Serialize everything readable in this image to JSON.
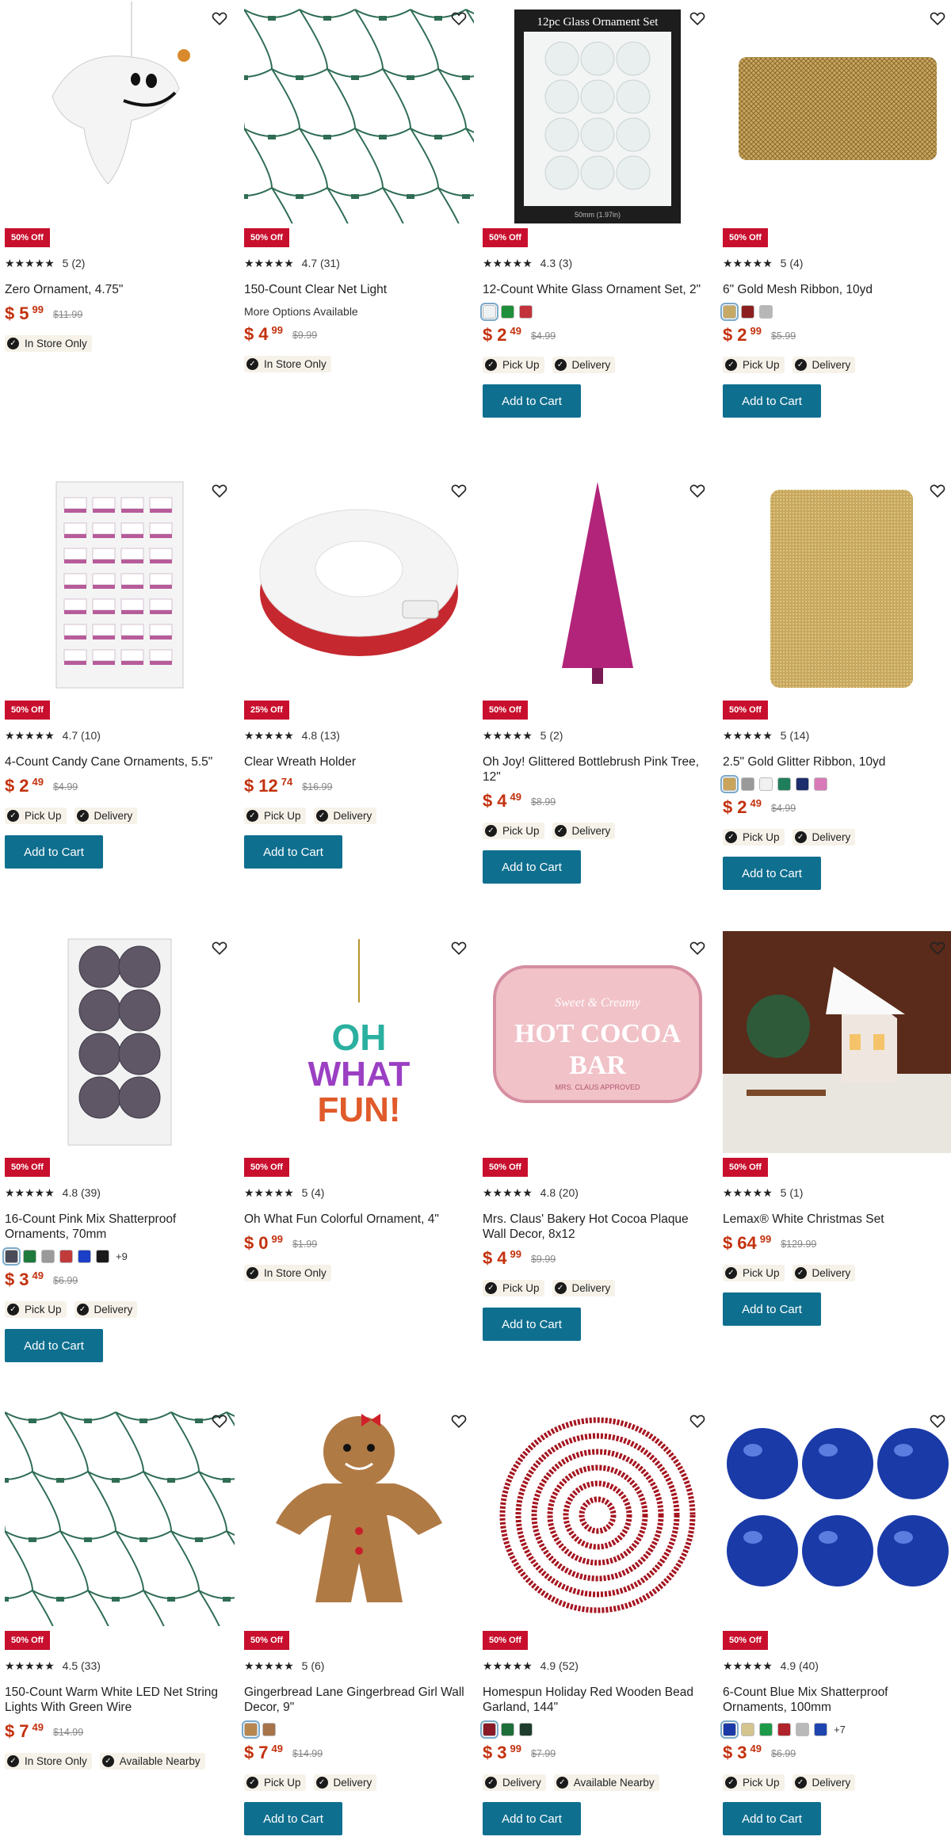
{
  "colors": {
    "sale_badge": "#c8102e",
    "price": "#c3310e",
    "button": "#0f6f8f"
  },
  "products": [
    {
      "name": "Zero Ornament, 4.75\"",
      "badge": "50% Off",
      "rating": "5",
      "reviews": "(2)",
      "currency": "$",
      "dollars": "5",
      "cents": "99",
      "was": "$11.99",
      "pills": [
        "In Store Only"
      ],
      "cart": ""
    },
    {
      "name": "150-Count Clear Net Light",
      "more": "More Options Available",
      "badge": "50% Off",
      "rating": "4.7",
      "reviews": "(31)",
      "currency": "$",
      "dollars": "4",
      "cents": "99",
      "was": "$9.99",
      "pills": [
        "In Store Only"
      ],
      "cart": ""
    },
    {
      "name": "12-Count White Glass Ornament Set, 2\"",
      "badge": "50% Off",
      "rating": "4.3",
      "reviews": "(3)",
      "currency": "$",
      "dollars": "2",
      "cents": "49",
      "was": "$4.99",
      "pills": [
        "Pick Up",
        "Delivery"
      ],
      "cart": "Add to Cart",
      "image_label": "12pc Glass Ornament Set",
      "image_caption": "50mm (1.97in)"
    },
    {
      "name": "6\" Gold Mesh Ribbon, 10yd",
      "badge": "50% Off",
      "rating": "5",
      "reviews": "(4)",
      "currency": "$",
      "dollars": "2",
      "cents": "99",
      "was": "$5.99",
      "pills": [
        "Pick Up",
        "Delivery"
      ],
      "cart": "Add to Cart"
    },
    {
      "name": "4-Count Candy Cane Ornaments, 5.5\"",
      "badge": "50% Off",
      "rating": "4.7",
      "reviews": "(10)",
      "currency": "$",
      "dollars": "2",
      "cents": "49",
      "was": "$4.99",
      "pills": [
        "Pick Up",
        "Delivery"
      ],
      "cart": "Add to Cart"
    },
    {
      "name": "Clear Wreath Holder",
      "badge": "25% Off",
      "rating": "4.8",
      "reviews": "(13)",
      "currency": "$",
      "dollars": "12",
      "cents": "74",
      "was": "$16.99",
      "pills": [
        "Pick Up",
        "Delivery"
      ],
      "cart": "Add to Cart"
    },
    {
      "name": "Oh Joy! Glittered Bottlebrush Pink Tree, 12\"",
      "badge": "50% Off",
      "rating": "5",
      "reviews": "(2)",
      "currency": "$",
      "dollars": "4",
      "cents": "49",
      "was": "$8.99",
      "pills": [
        "Pick Up",
        "Delivery"
      ],
      "cart": "Add to Cart"
    },
    {
      "name": "2.5\" Gold Glitter Ribbon, 10yd",
      "badge": "50% Off",
      "rating": "5",
      "reviews": "(14)",
      "currency": "$",
      "dollars": "2",
      "cents": "49",
      "was": "$4.99",
      "pills": [
        "Pick Up",
        "Delivery"
      ],
      "cart": "Add to Cart"
    },
    {
      "name": "16-Count Pink Mix Shatterproof Ornaments, 70mm",
      "badge": "50% Off",
      "rating": "4.8",
      "reviews": "(39)",
      "currency": "$",
      "dollars": "3",
      "cents": "49",
      "was": "$6.99",
      "pills": [
        "Pick Up",
        "Delivery"
      ],
      "cart": "Add to Cart",
      "swatch_more": "+9"
    },
    {
      "name": "Oh What Fun Colorful Ornament, 4\"",
      "badge": "50% Off",
      "rating": "5",
      "reviews": "(4)",
      "currency": "$",
      "dollars": "0",
      "cents": "99",
      "was": "$1.99",
      "pills": [
        "In Store Only"
      ],
      "cart": "",
      "image_label": "OH WHAT FUN!"
    },
    {
      "name": "Mrs. Claus' Bakery Hot Cocoa Plaque Wall Decor, 8x12",
      "badge": "50% Off",
      "rating": "4.8",
      "reviews": "(20)",
      "currency": "$",
      "dollars": "4",
      "cents": "99",
      "was": "$9.99",
      "pills": [
        "Pick Up",
        "Delivery"
      ],
      "cart": "Add to Cart",
      "image_label": "HOT COCOA BAR",
      "image_sub": "Sweet & Creamy",
      "image_caption": "MRS. CLAUS APPROVED"
    },
    {
      "name": "Lemax® White Christmas Set",
      "badge": "50% Off",
      "rating": "5",
      "reviews": "(1)",
      "currency": "$",
      "dollars": "64",
      "cents": "99",
      "was": "$129.99",
      "pills": [
        "Pick Up",
        "Delivery"
      ],
      "cart": "Add to Cart"
    },
    {
      "name": "150-Count Warm White LED Net String Lights With Green Wire",
      "badge": "50% Off",
      "rating": "4.5",
      "reviews": "(33)",
      "currency": "$",
      "dollars": "7",
      "cents": "49",
      "was": "$14.99",
      "pills": [
        "In Store Only",
        "Available Nearby"
      ],
      "cart": ""
    },
    {
      "name": "Gingerbread Lane Gingerbread Girl Wall Decor, 9\"",
      "badge": "50% Off",
      "rating": "5",
      "reviews": "(6)",
      "currency": "$",
      "dollars": "7",
      "cents": "49",
      "was": "$14.99",
      "pills": [
        "Pick Up",
        "Delivery"
      ],
      "cart": "Add to Cart"
    },
    {
      "name": "Homespun Holiday Red Wooden Bead Garland, 144\"",
      "badge": "50% Off",
      "rating": "4.9",
      "reviews": "(52)",
      "currency": "$",
      "dollars": "3",
      "cents": "99",
      "was": "$7.99",
      "pills": [
        "Delivery",
        "Available Nearby"
      ],
      "cart": "Add to Cart"
    },
    {
      "name": "6-Count Blue Mix Shatterproof Ornaments, 100mm",
      "badge": "50% Off",
      "rating": "4.9",
      "reviews": "(40)",
      "currency": "$",
      "dollars": "3",
      "cents": "49",
      "was": "$6.99",
      "pills": [
        "Pick Up",
        "Delivery"
      ],
      "cart": "Add to Cart",
      "swatch_more": "+7"
    }
  ],
  "swatch_colors": {
    "2": [
      "#eef2f2",
      "#1e8f3a",
      "#c2333b"
    ],
    "3": [
      "#c6a964",
      "#8c2020",
      "#b7b7b7"
    ],
    "7": [
      "#c9a45a",
      "#9a9a9a",
      "#f1f1f1",
      "#1f7f5a",
      "#1d2d6b",
      "#d97ab8"
    ],
    "8": [
      "#4a4a58",
      "#1e7a3c",
      "#9a9a9a",
      "#c23b3b",
      "#1b3fc7",
      "#1a1a1a"
    ],
    "13": [
      "#b8874e",
      "#a7744a"
    ],
    "14": [
      "#8a1b26",
      "#1e6e3a",
      "#1f3d2c"
    ],
    "15": [
      "#1b3aa8",
      "#d4c48e",
      "#1c9a4a",
      "#b1232b",
      "#b9b9b9",
      "#1f45b0"
    ]
  },
  "icons": {
    "favorite": "heart-outline-icon",
    "available": "check-circle-icon",
    "rating": "star-icon"
  }
}
